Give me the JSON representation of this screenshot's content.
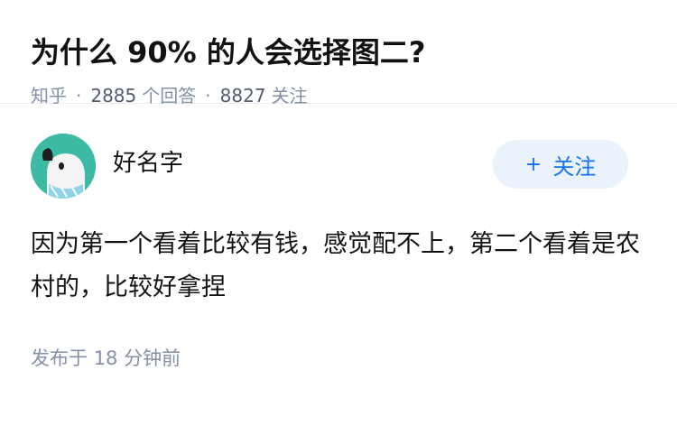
{
  "question": {
    "title": "为什么 90% 的人会选择图二?",
    "source": "知乎",
    "separator": "·",
    "answer_count": "2885",
    "answer_label": "个回答",
    "follow_count": "8827",
    "follow_label": "关注"
  },
  "answer": {
    "author_name": "好名字",
    "follow_button_label": "关注",
    "follow_button_icon": "+",
    "content": "因为第一个看着比较有钱，感觉配不上，第二个看着是农村的，比较好拿捏",
    "time_label": "发布于",
    "time_value": "18 分钟前"
  },
  "colors": {
    "title": "#121212",
    "meta": "#8590a6",
    "avatar_bg": "#3dbaa4",
    "follow_bg": "#eaf2fc",
    "follow_text": "#1772f6"
  }
}
